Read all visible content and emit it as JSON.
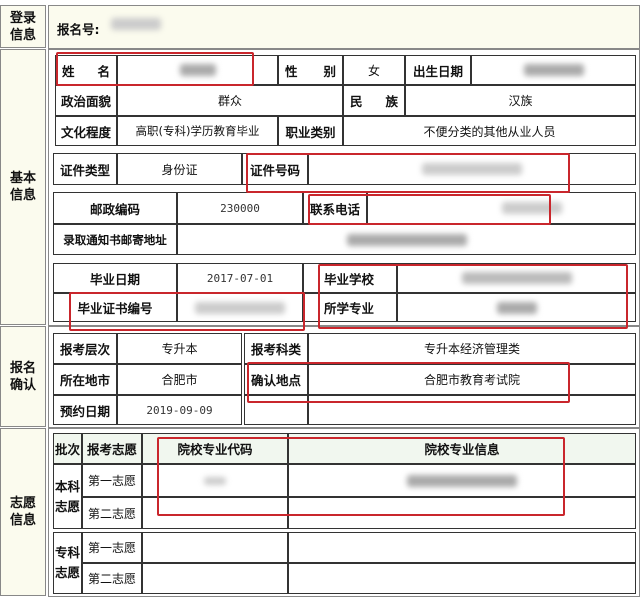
{
  "sections": {
    "login": "登录信息",
    "basic": "基本信息",
    "confirm": "报名确认",
    "wish": "志愿信息"
  },
  "login": {
    "reg_no_label": "报名号:"
  },
  "basic": {
    "name_label_1": "姓",
    "name_label_2": "名",
    "gender_label_1": "性",
    "gender_label_2": "别",
    "gender": "女",
    "birth_label": "出生日期",
    "political_label": "政治面貌",
    "political": "群众",
    "ethnic_label_1": "民",
    "ethnic_label_2": "族",
    "ethnic": "汉族",
    "education_label": "文化程度",
    "education": "高职(专科)学历教育毕业",
    "occupation_label": "职业类别",
    "occupation": "不便分类的其他从业人员",
    "id_type_label": "证件类型",
    "id_type": "身份证",
    "id_no_label": "证件号码",
    "postcode_label": "邮政编码",
    "postcode": "230000",
    "phone_label": "联系电话",
    "address_label": "录取通知书邮寄地址",
    "grad_date_label": "毕业日期",
    "grad_date": "2017-07-01",
    "school_label": "毕业学校",
    "cert_no_label": "毕业证书编号",
    "major_label": "所学专业"
  },
  "confirm": {
    "level_label": "报考层次",
    "level": "专升本",
    "subject_label": "报考科类",
    "subject": "专升本经济管理类",
    "city_label": "所在地市",
    "city": "合肥市",
    "place_label": "确认地点",
    "place": "合肥市教育考试院",
    "date_label": "预约日期",
    "date": "2019-09-09"
  },
  "wish": {
    "headers": [
      "批次",
      "报考志愿",
      "院校专业代码",
      "院校专业信息"
    ],
    "batches": [
      "本科志愿",
      "专科志愿"
    ],
    "choices": [
      "第一志愿",
      "第二志愿"
    ]
  },
  "colors": {
    "highlight": "#c9262c",
    "label_bg": "#fbfbee"
  }
}
